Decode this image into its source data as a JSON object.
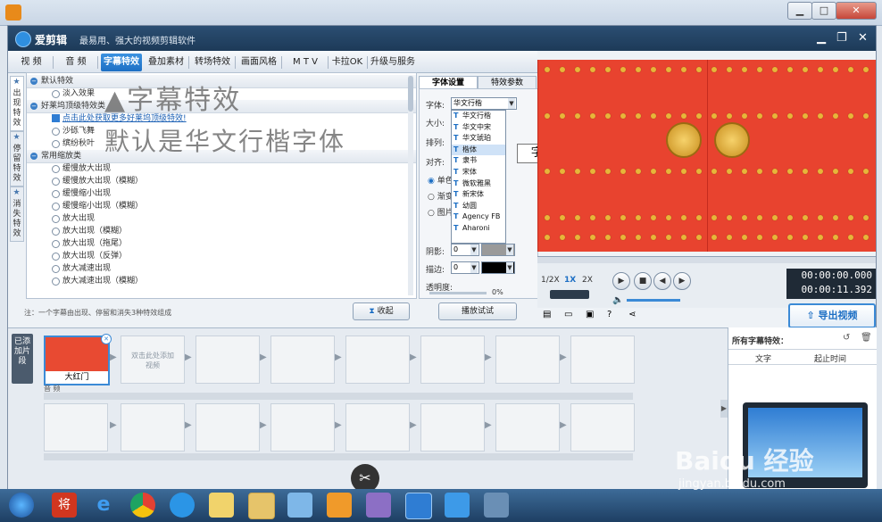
{
  "window": {
    "minimize": "▁",
    "maximize": "□",
    "close": "✕"
  },
  "app": {
    "name": "爱剪辑",
    "slogan": "最易用、强大的视频剪辑软件",
    "tabs": [
      "视 频",
      "音 频",
      "字幕特效",
      "叠加素材",
      "转场特效",
      "画面风格",
      "M T V",
      "卡拉OK",
      "升级与服务"
    ],
    "active_tab": "字幕特效"
  },
  "side_tabs": [
    "出现特效",
    "停留特效",
    "消失特效"
  ],
  "effects": {
    "rows": [
      {
        "kind": "cat",
        "text": "默认特效"
      },
      {
        "kind": "item",
        "text": "淡入效果"
      },
      {
        "kind": "cat",
        "text": "好莱坞顶级特效类"
      },
      {
        "kind": "link",
        "text": "点击此处获取更多好莱坞顶级特效!"
      },
      {
        "kind": "item",
        "text": "沙砾飞舞"
      },
      {
        "kind": "item",
        "text": "缤纷秋叶"
      },
      {
        "kind": "cat",
        "text": "常用缩放类"
      },
      {
        "kind": "item",
        "text": "缓慢放大出现"
      },
      {
        "kind": "item",
        "text": "缓慢放大出现（模糊）"
      },
      {
        "kind": "item",
        "text": "缓慢缩小出现"
      },
      {
        "kind": "item",
        "text": "缓慢缩小出现（模糊）"
      },
      {
        "kind": "item",
        "text": "放大出现"
      },
      {
        "kind": "item",
        "text": "放大出现（模糊）"
      },
      {
        "kind": "item",
        "text": "放大出现（拖尾）"
      },
      {
        "kind": "item",
        "text": "放大出现（反弹）"
      },
      {
        "kind": "item",
        "text": "放大减速出现"
      },
      {
        "kind": "item",
        "text": "放大减速出现（模糊）"
      }
    ]
  },
  "overlay": {
    "line1": "▲字幕特效",
    "line2": "默认是华文行楷字体"
  },
  "note": "注：一个字幕由出现、停留和消失3种特效组成",
  "collapse_button": "收起",
  "settings": {
    "tabs": [
      "字体设置",
      "特效参数"
    ],
    "font_label": "字体:",
    "font_value": "华文行楷",
    "size_label": "大小:",
    "arrange_label": "排列:",
    "align_label": "对齐:",
    "options": [
      "单色",
      "渐变",
      "图片"
    ],
    "shadow_label": "阴影:",
    "shadow_value": "0",
    "border_label": "描边:",
    "border_value": "0",
    "opacity_label": "透明度:",
    "opacity_value": "0%",
    "preview_button": "播放试试",
    "font_list": [
      "华文行楷",
      "华文中宋",
      "华文琥珀",
      "楷体",
      "隶书",
      "宋体",
      "微软雅黑",
      "新宋体",
      "幼圆",
      "Agency FB",
      "Aharoni"
    ],
    "selected_font": "楷体"
  },
  "tooltip": "字体 Font",
  "player": {
    "speeds": [
      "1/2X",
      "1X",
      "2X"
    ],
    "active_speed": "1X",
    "time_current": "00:00:00.000",
    "time_total": "00:00:11.392",
    "export_button": "导出视频"
  },
  "timeline": {
    "added_tab": "已添加片段",
    "clip_label": "大红门",
    "empty_clip_hint": "双击此处添加视频",
    "audio_label": "音 频"
  },
  "right_panel": {
    "title": "所有字幕特效：",
    "col_text": "文字",
    "col_time": "起止时间"
  },
  "watermark": {
    "brand": "Baidu 经验",
    "url": "jingyan.baidu.com"
  },
  "colors": {
    "accent": "#1d6fc4",
    "preview_bg": "#e23a2a",
    "stud": "#e8b53a"
  }
}
